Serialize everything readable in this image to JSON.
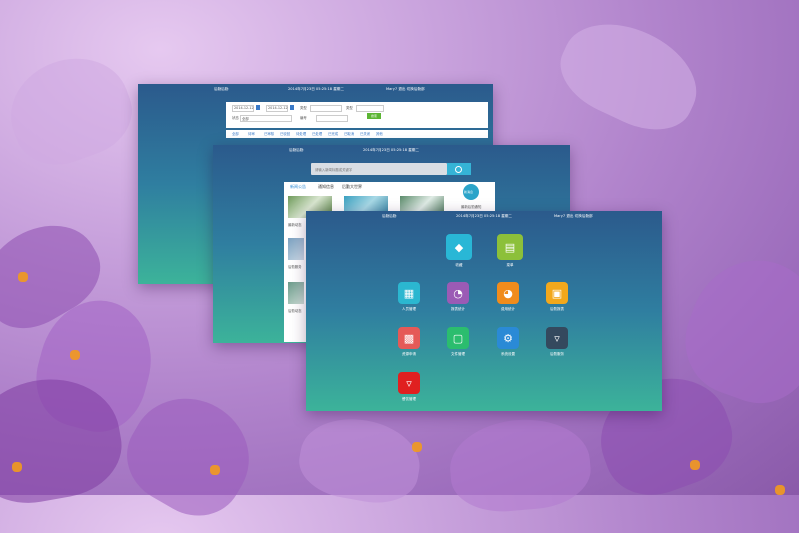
{
  "window_back": {
    "title": "后勤后勤",
    "datetime": "2014年7月23日 05:25:18 星期二",
    "user": "Mary7 退出 切换后勤部",
    "form": {
      "field1": "2014-12-12",
      "field2": "2014-12-12",
      "field3_label": "类型",
      "field4_label": "类型",
      "button": "搜索",
      "row2_label": "状态",
      "row2_value": "全部",
      "row2_label2": "编号"
    },
    "tabs": [
      "全部",
      "待审",
      "已审核",
      "已驳回",
      "待处理",
      "已处理",
      "已完成",
      "已取消",
      "已关闭",
      "其他"
    ]
  },
  "window_mid": {
    "title": "后勤后勤",
    "datetime": "2014年7月23日 05:25:18 星期二",
    "search_placeholder": "请输入新闻标题或关键字",
    "tabs": [
      "新闻公告",
      "通知信息",
      "后勤大世界"
    ],
    "news_titles": [
      "最新动态",
      "后勤服务",
      "后勤动态"
    ],
    "side_badge": "新消息",
    "side_text": "最新后勤通知"
  },
  "window_front": {
    "title": "后勤后勤",
    "datetime": "2014年7月23日 05:25:18 星期二",
    "user": "Mary7 退出 切换后勤部",
    "apps": [
      {
        "label": "收藏",
        "icon": "tag-icon",
        "color": "#29b7d6"
      },
      {
        "label": "菜单",
        "icon": "printer-icon",
        "color": "#8cc03a"
      },
      {
        "label": "人员管理",
        "icon": "card-icon",
        "color": "#2bb7d0"
      },
      {
        "label": "报表统计",
        "icon": "pie-chart-icon",
        "color": "#9b5bb5"
      },
      {
        "label": "费用统计",
        "icon": "pie-chart-icon",
        "color": "#f08c1c"
      },
      {
        "label": "后勤报表",
        "icon": "document-icon",
        "color": "#f2a81c"
      },
      {
        "label": "资源申请",
        "icon": "note-icon",
        "color": "#e55a57"
      },
      {
        "label": "文件管理",
        "icon": "document-settings-icon",
        "color": "#2bbd6e"
      },
      {
        "label": "系统设置",
        "icon": "gear-icon",
        "color": "#2a8ad6"
      },
      {
        "label": "后勤服务",
        "icon": "cocktail-icon",
        "color": "#34495e"
      },
      {
        "label": "餐饮管理",
        "icon": "cocktail-icon",
        "color": "#e02020"
      }
    ]
  }
}
